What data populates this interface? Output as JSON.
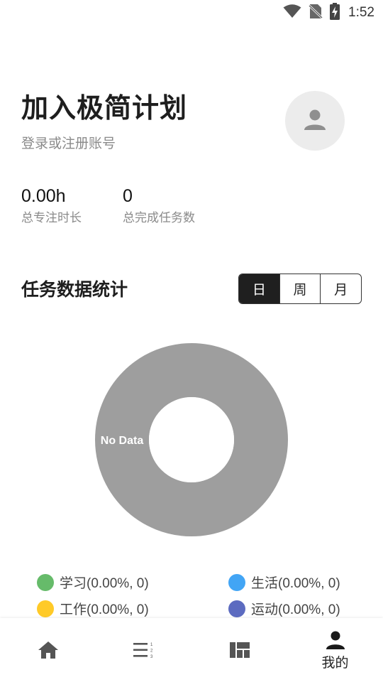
{
  "status_bar": {
    "time": "1:52",
    "icons": [
      "wifi-icon",
      "no-sim-icon",
      "battery-charging-icon"
    ]
  },
  "profile": {
    "title": "加入极简计划",
    "subtitle": "登录或注册账号",
    "avatar_icon": "person-icon"
  },
  "stats": [
    {
      "value": "0.00h",
      "label": "总专注时长"
    },
    {
      "value": "0",
      "label": "总完成任务数"
    }
  ],
  "task_stats": {
    "title": "任务数据统计",
    "periods": [
      "日",
      "周",
      "月"
    ],
    "selected_period": "日"
  },
  "chart_data": {
    "type": "pie",
    "variant": "donut",
    "center_text": "No Data",
    "series": [
      {
        "name": "学习",
        "percent": "0.00%",
        "count": 0,
        "color": "#66bb6a"
      },
      {
        "name": "生活",
        "percent": "0.00%",
        "count": 0,
        "color": "#42a5f5"
      },
      {
        "name": "工作",
        "percent": "0.00%",
        "count": 0,
        "color": "#ffca28"
      },
      {
        "name": "运动",
        "percent": "0.00%",
        "count": 0,
        "color": "#5c6bc0"
      }
    ],
    "legend_labels": [
      "学习(0.00%, 0)",
      "生活(0.00%, 0)",
      "工作(0.00%, 0)",
      "运动(0.00%, 0)"
    ],
    "empty_color": "#9e9e9e"
  },
  "bottom_nav": [
    {
      "icon": "home-icon",
      "label": ""
    },
    {
      "icon": "ordered-list-icon",
      "label": ""
    },
    {
      "icon": "dashboard-icon",
      "label": ""
    },
    {
      "icon": "person-icon",
      "label": "我的",
      "active": true
    }
  ]
}
